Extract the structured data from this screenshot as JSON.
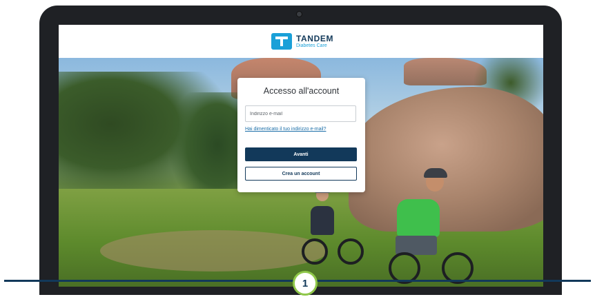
{
  "brand": {
    "name": "TANDEM",
    "subtitle": "Diabetes Care",
    "logo_icon": "tandem-logo-icon",
    "color_primary": "#12395a",
    "color_accent": "#1aa0d8"
  },
  "login": {
    "title": "Accesso all'account",
    "email_placeholder": "Indirizzo e-mail",
    "forgot_email_link": "Hai dimenticato il tuo indirizzo e-mail?",
    "next_button": "Avanti",
    "create_account_button": "Crea un account"
  },
  "step": {
    "number": "1",
    "badge_color": "#8fc74a"
  }
}
